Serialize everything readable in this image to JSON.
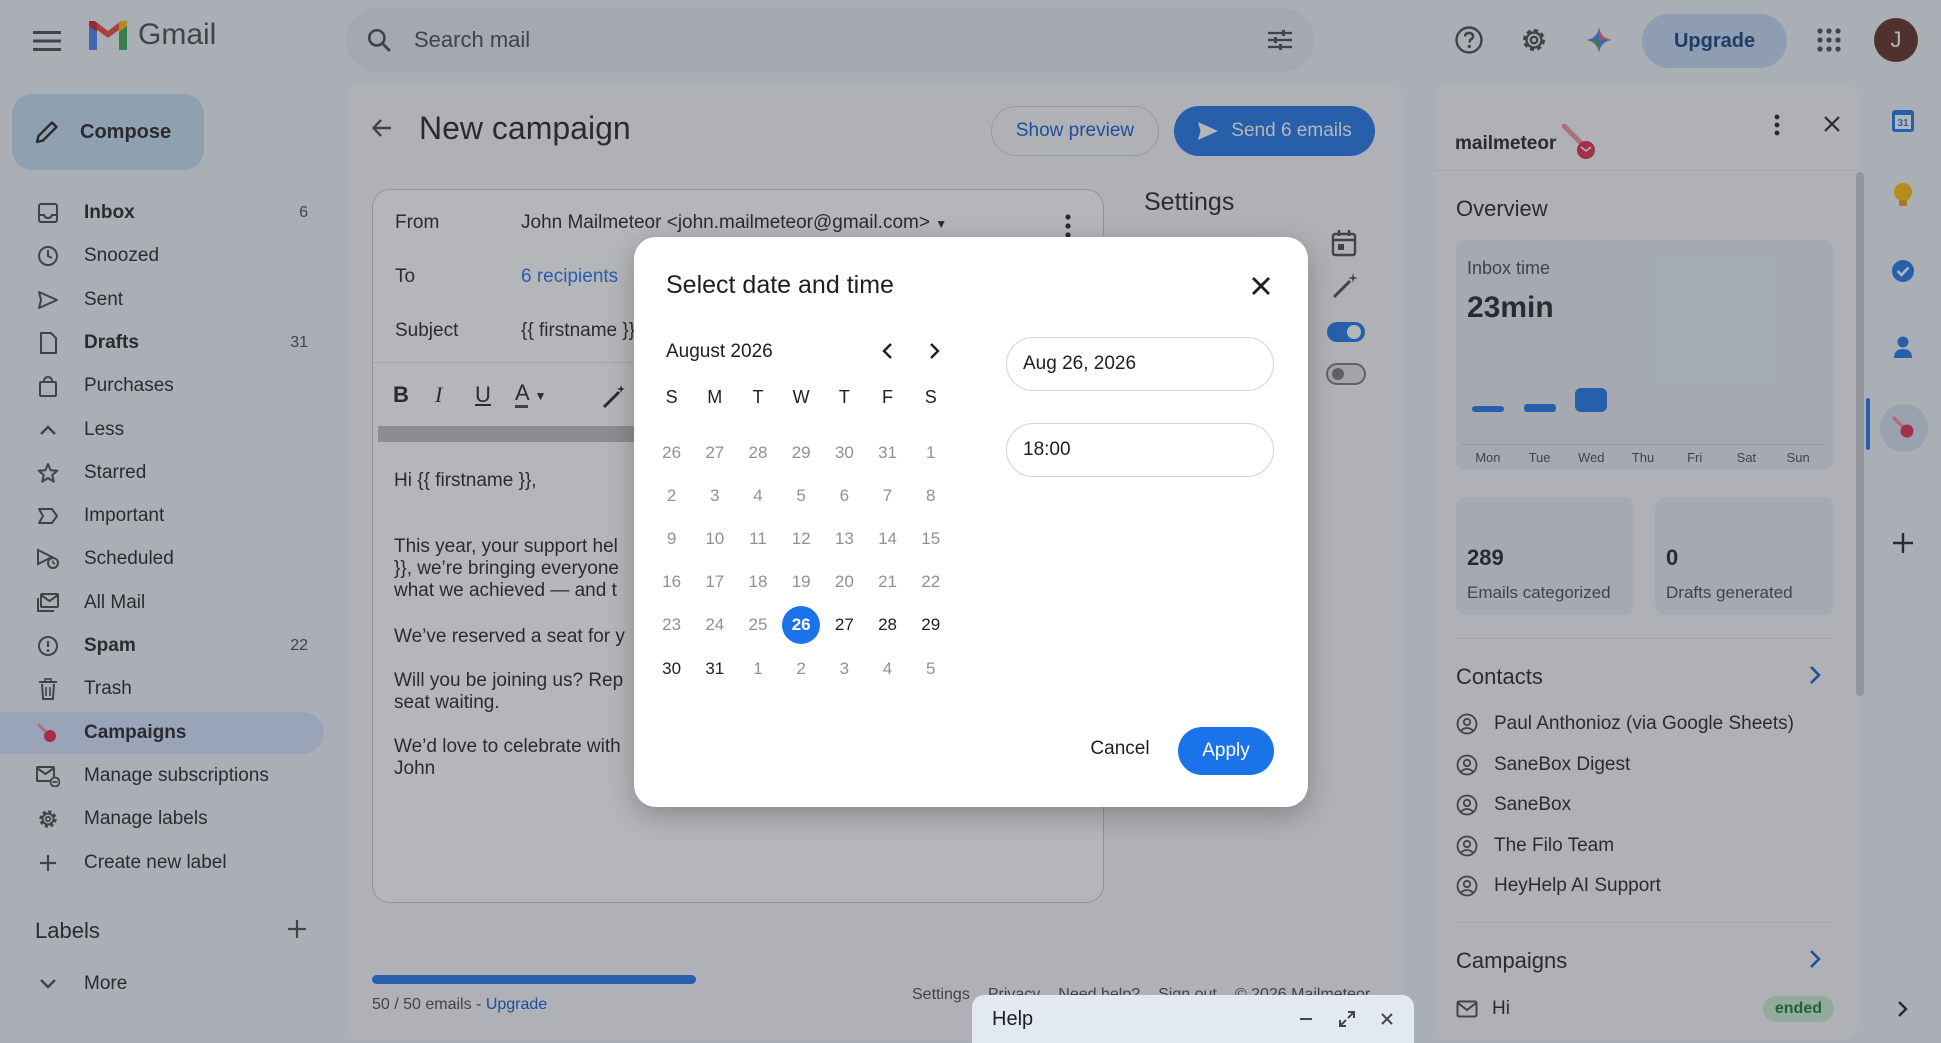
{
  "app": {
    "name": "Gmail"
  },
  "search": {
    "placeholder": "Search mail"
  },
  "header": {
    "upgrade_label": "Upgrade",
    "avatar_initial": "J"
  },
  "sidebar": {
    "compose_label": "Compose",
    "items": [
      {
        "label": "Inbox",
        "count": "6",
        "icon": "inbox-icon",
        "bold": true
      },
      {
        "label": "Snoozed",
        "count": "",
        "icon": "clock-icon",
        "bold": false
      },
      {
        "label": "Sent",
        "count": "",
        "icon": "send-icon",
        "bold": false
      },
      {
        "label": "Drafts",
        "count": "31",
        "icon": "draft-icon",
        "bold": true
      },
      {
        "label": "Purchases",
        "count": "",
        "icon": "shopping-bag-icon",
        "bold": false
      },
      {
        "label": "Less",
        "count": "",
        "icon": "chevron-up-icon",
        "bold": false
      },
      {
        "label": "Starred",
        "count": "",
        "icon": "star-icon",
        "bold": false
      },
      {
        "label": "Important",
        "count": "",
        "icon": "important-icon",
        "bold": false
      },
      {
        "label": "Scheduled",
        "count": "",
        "icon": "scheduled-icon",
        "bold": false
      },
      {
        "label": "All Mail",
        "count": "",
        "icon": "all-mail-icon",
        "bold": false
      },
      {
        "label": "Spam",
        "count": "22",
        "icon": "spam-icon",
        "bold": true
      },
      {
        "label": "Trash",
        "count": "",
        "icon": "trash-icon",
        "bold": false
      },
      {
        "label": "Campaigns",
        "count": "",
        "icon": "mailmeteor-icon",
        "bold": true
      },
      {
        "label": "Manage subscriptions",
        "count": "",
        "icon": "manage-subscriptions-icon",
        "bold": false
      },
      {
        "label": "Manage labels",
        "count": "",
        "icon": "gear-icon",
        "bold": false
      },
      {
        "label": "Create new label",
        "count": "",
        "icon": "plus-icon",
        "bold": false
      }
    ],
    "labels_heading": "Labels",
    "more_label": "More"
  },
  "campaign": {
    "title": "New campaign",
    "show_preview_label": "Show preview",
    "send_label": "Send 6 emails",
    "from_label": "From",
    "from_value": "John Mailmeteor <john.mailmeteor@gmail.com>",
    "to_label": "To",
    "to_value": "6 recipients",
    "subject_label": "Subject",
    "subject_value": "{{ firstname }}",
    "body": {
      "greeting": "Hi {{ firstname }},",
      "p1_l1": "This year, your support hel",
      "p1_l2": "}}, we’re bringing everyone",
      "p1_l3": "what we achieved — and t",
      "p2": "We’ve reserved a seat for y",
      "p3_l1": "Will you be joining us? Rep",
      "p3_l2": "seat waiting.",
      "p4_l1": "We’d love to celebrate with",
      "p4_l2": "John"
    },
    "settings_title": "Settings"
  },
  "progress": {
    "text": "50 / 50 emails - ",
    "upgrade": "Upgrade",
    "fraction": 1.0
  },
  "footer": {
    "settings": "Settings",
    "privacy": "Privacy",
    "help": "Need help?",
    "signout": "Sign out",
    "copyright": "© 2026 Mailmeteor"
  },
  "help_bar": {
    "title": "Help"
  },
  "side_panel": {
    "logo_text": "mailmeteor",
    "overview_title": "Overview",
    "inbox_time_label": "Inbox time",
    "inbox_time_value": "23min",
    "week_days": [
      "Mon",
      "Tue",
      "Wed",
      "Thu",
      "Fri",
      "Sat",
      "Sun"
    ],
    "week_levels": [
      0.15,
      0.2,
      0.6,
      0,
      0,
      0,
      0
    ],
    "emails_categorized_value": "289",
    "emails_categorized_label": "Emails categorized",
    "drafts_generated_value": "0",
    "drafts_generated_label": "Drafts generated",
    "contacts_title": "Contacts",
    "contacts": [
      "Paul Anthonioz (via Google Sheets)",
      "SaneBox Digest",
      "SaneBox",
      "The Filo Team",
      "HeyHelp AI Support"
    ],
    "campaigns_title": "Campaigns",
    "campaign_name": "Hi",
    "campaign_status": "ended"
  },
  "dialog": {
    "title": "Select date and time",
    "month_label": "August 2026",
    "weekdays": [
      "S",
      "M",
      "T",
      "W",
      "T",
      "F",
      "S"
    ],
    "days": [
      [
        "26",
        "27",
        "28",
        "29",
        "30",
        "31",
        "1"
      ],
      [
        "2",
        "3",
        "4",
        "5",
        "6",
        "7",
        "8"
      ],
      [
        "9",
        "10",
        "11",
        "12",
        "13",
        "14",
        "15"
      ],
      [
        "16",
        "17",
        "18",
        "19",
        "20",
        "21",
        "22"
      ],
      [
        "23",
        "24",
        "25",
        "26",
        "27",
        "28",
        "29"
      ],
      [
        "30",
        "31",
        "1",
        "2",
        "3",
        "4",
        "5"
      ]
    ],
    "selected_day": "26",
    "date_value": "Aug 26, 2026",
    "time_value": "18:00",
    "cancel_label": "Cancel",
    "apply_label": "Apply"
  },
  "colors": {
    "accent": "#1a73e8",
    "scrim": "#3c4046"
  }
}
